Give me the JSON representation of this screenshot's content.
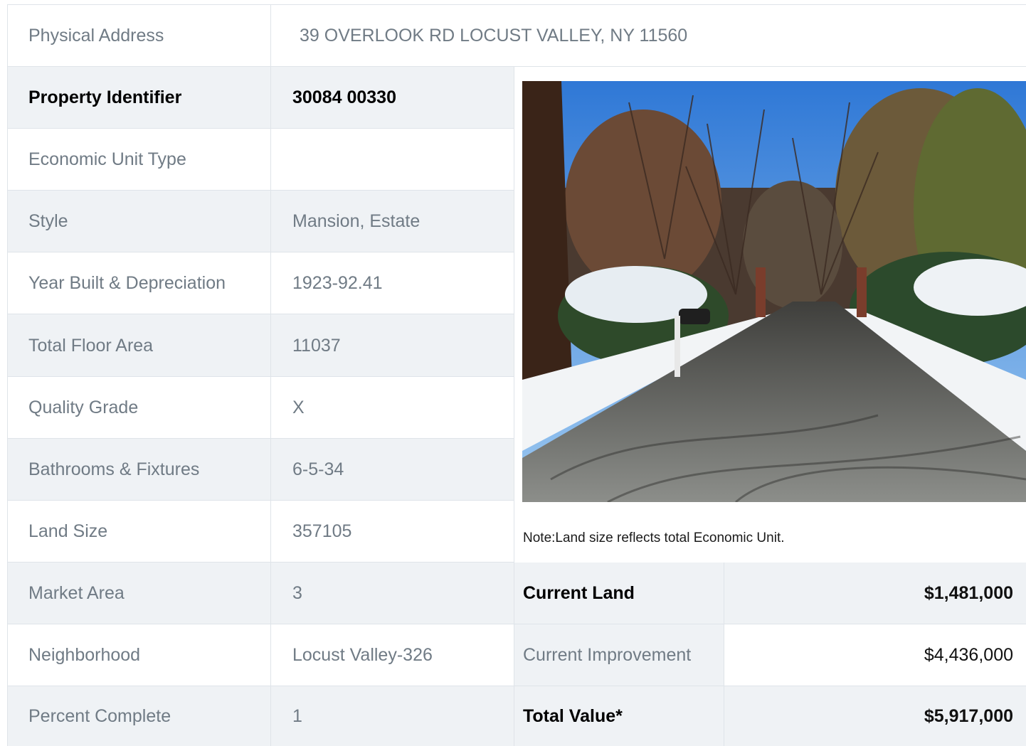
{
  "address": {
    "label": "Physical Address",
    "value": "39  OVERLOOK RD  LOCUST VALLEY, NY  11560"
  },
  "details": [
    {
      "label": "Property Identifier",
      "value": "30084  00330"
    },
    {
      "label": "Economic Unit Type",
      "value": ""
    },
    {
      "label": "Style",
      "value": "Mansion, Estate"
    },
    {
      "label": "Year Built & Depreciation",
      "value": "1923-92.41"
    },
    {
      "label": "Total Floor Area",
      "value": "11037"
    },
    {
      "label": "Quality Grade",
      "value": "X"
    },
    {
      "label": "Bathrooms & Fixtures",
      "value": "6-5-34"
    },
    {
      "label": "Land Size",
      "value": "357105"
    },
    {
      "label": "Market Area",
      "value": "3"
    },
    {
      "label": "Neighborhood",
      "value": "Locust Valley-326"
    },
    {
      "label": "Percent Complete",
      "value": "1"
    }
  ],
  "note": "Note:Land size reflects total Economic Unit.",
  "values": [
    {
      "label": "Current Land",
      "value": "$1,481,000"
    },
    {
      "label": "Current Improvement",
      "value": "$4,436,000"
    },
    {
      "label": "Total Value*",
      "value": "$5,917,000"
    }
  ],
  "colors": {
    "shade": "#eff2f5",
    "border": "#dfe4e9",
    "muted_text": "#707b85"
  }
}
